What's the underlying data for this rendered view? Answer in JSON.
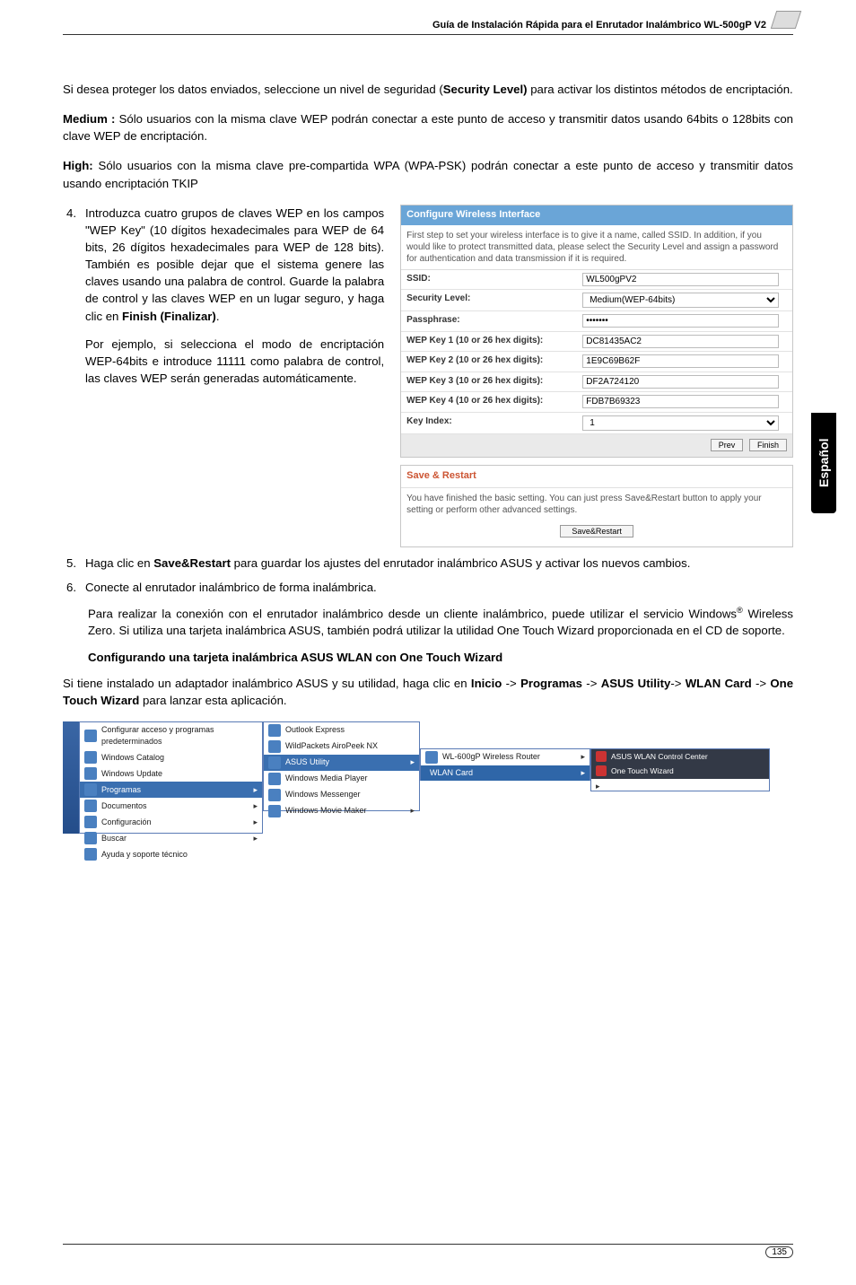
{
  "header": {
    "guide": "Guía de Instalación Rápida para el Enrutador Inalámbrico WL-500gP V2"
  },
  "p1": "Si desea proteger los datos enviados, seleccione un nivel de seguridad (",
  "p1b": "Security Level)",
  "p1c": " para activar los distintos métodos de encriptación.",
  "p2a": "Medium :",
  "p2b": " Sólo usuarios con la misma clave WEP podrán conectar a este punto de acceso y transmitir datos usando 64bits o 128bits con clave WEP de encriptación.",
  "p3a": "High:",
  "p3b": " Sólo usuarios con la misma clave pre-compartida WPA (WPA-PSK) podrán conectar a este punto de acceso y transmitir datos usando encriptación TKIP",
  "step4_num": "4.",
  "step4_a": "Introduzca cuatro grupos de claves WEP en los campos \"WEP Key\" (10 dígitos hexadecimales para WEP de 64 bits, 26 dígitos hexadecimales para WEP de 128 bits). También es posible dejar que el sistema genere las claves usando una palabra de control. Guarde la palabra de control y las claves WEP en un lugar seguro, y haga clic en ",
  "step4_b": "Finish (Finalizar)",
  "step4_c": ".",
  "step4_p2": "Por ejemplo, si selecciona el modo de encriptación WEP-64bits e introduce 11111 como palabra de control, las claves WEP serán generadas automáticamente.",
  "cfg": {
    "title": "Configure Wireless Interface",
    "desc": "First step to set your wireless interface is to give it a name, called SSID. In addition, if you would like to protect transmitted data, please select the Security Level and assign a password for authentication and data transmission if it is required.",
    "rows": {
      "ssid_l": "SSID:",
      "ssid_v": "WL500gPV2",
      "sec_l": "Security Level:",
      "sec_v": "Medium(WEP-64bits)",
      "pass_l": "Passphrase:",
      "pass_v": "•••••••",
      "k1_l": "WEP Key 1 (10 or 26 hex digits):",
      "k1_v": "DC81435AC2",
      "k2_l": "WEP Key 2 (10 or 26 hex digits):",
      "k2_v": "1E9C69B62F",
      "k3_l": "WEP Key 3 (10 or 26 hex digits):",
      "k3_v": "DF2A724120",
      "k4_l": "WEP Key 4 (10 or 26 hex digits):",
      "k4_v": "FDB7B69323",
      "ki_l": "Key Index:",
      "ki_v": "1"
    },
    "btn_prev": "Prev",
    "btn_finish": "Finish"
  },
  "restart": {
    "title": "Save & Restart",
    "desc": "You have finished the basic setting. You can just press Save&Restart button to apply your setting or perform other advanced settings.",
    "btn": "Save&Restart"
  },
  "side_tab": "Español",
  "step5_num": "5.",
  "step5_a": "Haga clic en ",
  "step5_b": "Save&Restart",
  "step5_c": " para guardar los ajustes del enrutador inalámbrico ASUS y activar los nuevos cambios.",
  "step6_num": "6.",
  "step6": "Conecte al enrutador inalámbrico de forma inalámbrica.",
  "step6_p2a": "Para realizar la conexión con el enrutador inalámbrico desde un cliente inalámbrico, puede utilizar el servicio Windows",
  "step6_p2b": " Wireless Zero. Si utiliza una tarjeta inalámbrica ASUS, también podrá utilizar la utilidad One Touch Wizard proporcionada en el CD de soporte.",
  "sup": "®",
  "h2": "Configurando una tarjeta inalámbrica ASUS WLAN con One Touch Wizard",
  "p_last_a": "Si tiene instalado un adaptador inalámbrico ASUS y su utilidad, haga clic en ",
  "p_last_b": "Inicio",
  "p_last_c": " -> ",
  "p_last_d": "Programas",
  "p_last_e": " -> ",
  "p_last_f": "ASUS Utility",
  "p_last_g": "-> ",
  "p_last_h": "WLAN Card",
  "p_last_i": " -> ",
  "p_last_j": "One Touch Wizard",
  "p_last_k": " para lanzar esta aplicación.",
  "sm": {
    "left": {
      "r1": "Configurar acceso y programas predeterminados",
      "r2": "Windows Catalog",
      "r3": "Windows Update",
      "r4": "Programas",
      "r5": "Documentos",
      "r6": "Configuración",
      "r7": "Buscar",
      "r8": "Ayuda y soporte técnico"
    },
    "mid": {
      "r1": "Outlook Express",
      "r2": "WildPackets AiroPeek NX",
      "r3": "ASUS Utility",
      "r4": "Windows Media Player",
      "r5": "Windows Messenger",
      "r6": "Windows Movie Maker"
    },
    "r1": {
      "a": "WL-600gP Wireless Router",
      "b": "WLAN Card"
    },
    "r2": {
      "a": "ASUS WLAN Control Center",
      "b": "One Touch Wizard"
    }
  },
  "page": "135"
}
